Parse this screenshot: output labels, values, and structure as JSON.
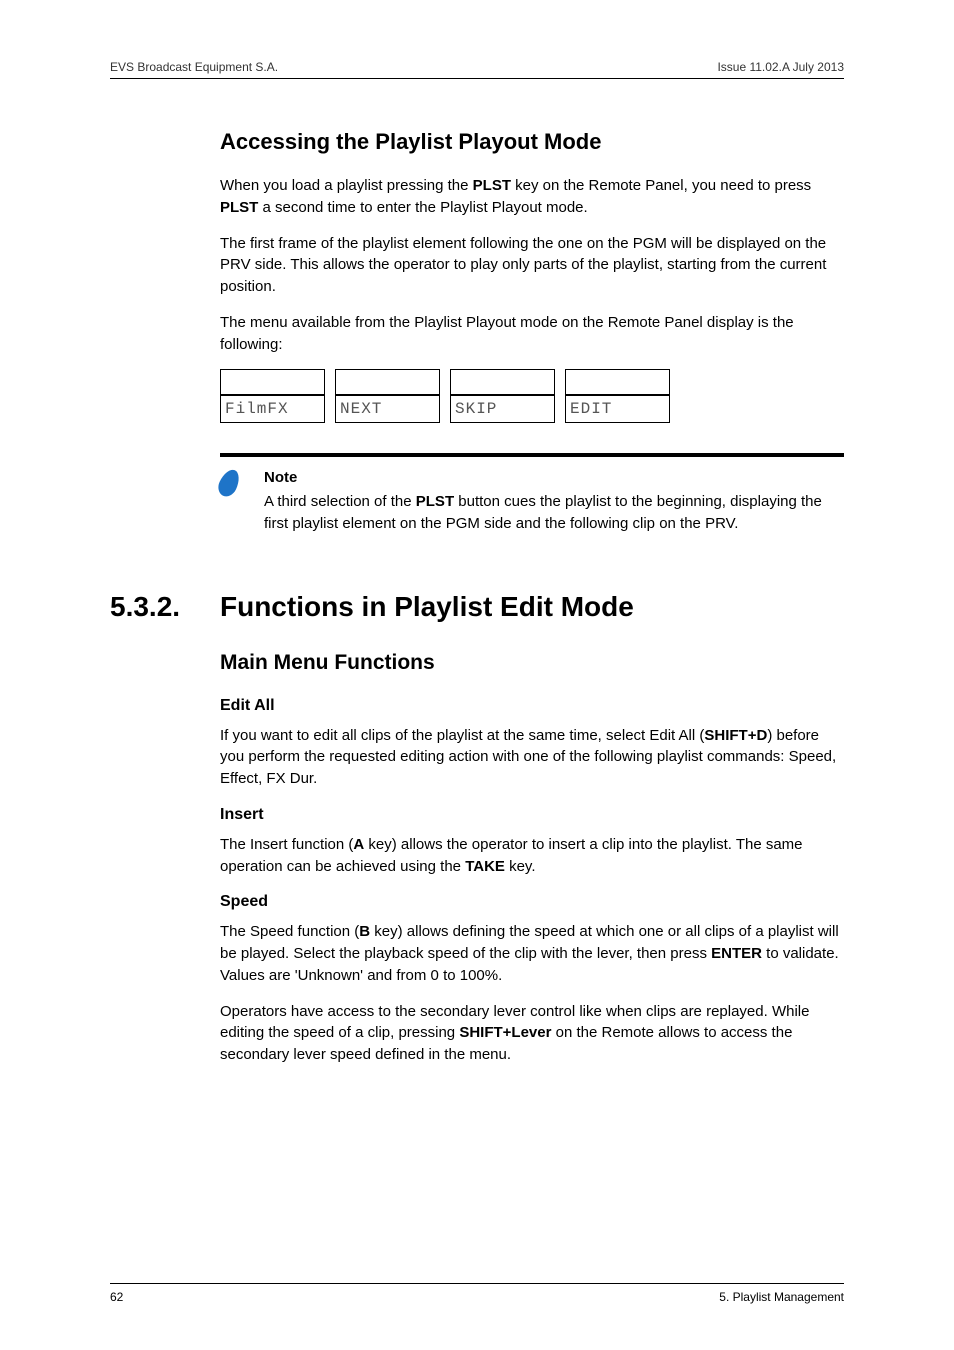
{
  "header": {
    "left": "EVS Broadcast Equipment S.A.",
    "right": "Issue 11.02.A  July 2013"
  },
  "section1": {
    "title": "Accessing the Playlist Playout Mode",
    "p1_a": "When you load a playlist pressing the ",
    "p1_b": "PLST",
    "p1_c": " key on the Remote Panel, you need to press ",
    "p1_d": "PLST",
    "p1_e": " a second time to enter the Playlist Playout mode.",
    "p2": "The first frame of the playlist element following the one on the PGM will be displayed on the PRV side. This allows the operator to play only parts of the playlist, starting from the current position.",
    "p3": "The menu available from the Playlist Playout mode on the Remote Panel display is the following:",
    "menu_top": [
      "",
      "",
      "",
      ""
    ],
    "menu_bottom": [
      "FilmFX",
      "NEXT",
      "SKIP",
      "EDIT"
    ]
  },
  "note": {
    "heading": "Note",
    "t1": "A third selection of the ",
    "t2": "PLST",
    "t3": " button cues the playlist to the beginning, displaying the first playlist element on the PGM side and the following clip on the PRV."
  },
  "section2": {
    "num": "5.3.2.",
    "title": "Functions in Playlist Edit Mode",
    "subhead": "Main Menu Functions",
    "editall": {
      "heading": "Edit All",
      "t1": "If you want to edit all clips of the playlist at the same time, select Edit All (",
      "t2": "SHIFT+D",
      "t3": ") before you perform the requested editing action with one of the following playlist commands: Speed, Effect, FX Dur."
    },
    "insert": {
      "heading": "Insert",
      "t1": "The Insert function (",
      "t2": "A",
      "t3": " key) allows the operator to insert a clip into the playlist. The same operation can be achieved using the ",
      "t4": "TAKE",
      "t5": " key."
    },
    "speed": {
      "heading": "Speed",
      "p1a": "The Speed function (",
      "p1b": "B",
      "p1c": " key) allows defining the speed at which one or all clips of a playlist will be played. Select the playback speed of the clip with the lever, then press ",
      "p1d": "ENTER",
      "p1e": " to validate. Values are 'Unknown' and from 0 to 100%.",
      "p2a": "Operators have access to the secondary lever control like when clips are replayed. While editing the speed of a clip, pressing ",
      "p2b": "SHIFT+Lever",
      "p2c": " on the Remote allows to access the secondary lever speed defined in the menu."
    }
  },
  "footer": {
    "left": "62",
    "right": "5. Playlist Management"
  }
}
